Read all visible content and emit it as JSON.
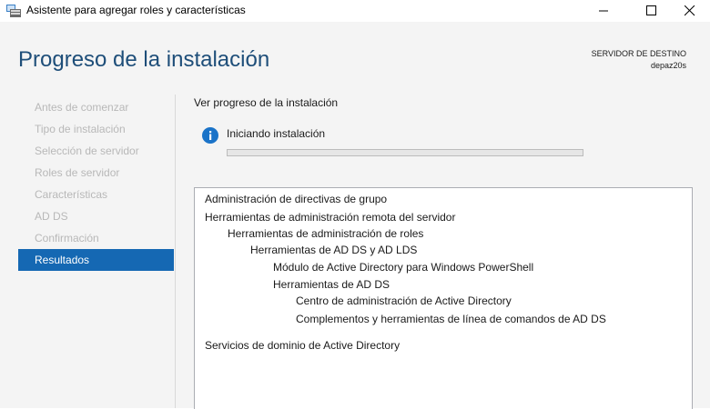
{
  "window": {
    "title": "Asistente para agregar roles y características",
    "icon": "server-manager-icon"
  },
  "header": {
    "page_title": "Progreso de la instalación",
    "server_label": "SERVIDOR DE DESTINO",
    "server_name": "depaz20s"
  },
  "sidebar": {
    "items": [
      {
        "label": "Antes de comenzar"
      },
      {
        "label": "Tipo de instalación"
      },
      {
        "label": "Selección de servidor"
      },
      {
        "label": "Roles de servidor"
      },
      {
        "label": "Características"
      },
      {
        "label": "AD DS"
      },
      {
        "label": "Confirmación"
      },
      {
        "label": "Resultados"
      }
    ],
    "active_index": 7
  },
  "main": {
    "section_label": "Ver progreso de la instalación",
    "status_icon": "info-icon",
    "status_text": "Iniciando instalación",
    "progress_fraction": 0,
    "results": [
      {
        "label": "Administración de directivas de grupo",
        "level": 0
      },
      {
        "label": "Herramientas de administración remota del servidor",
        "level": 0
      },
      {
        "label": "Herramientas de administración de roles",
        "level": 1
      },
      {
        "label": "Herramientas de AD DS y AD LDS",
        "level": 2
      },
      {
        "label": "Módulo de Active Directory para Windows PowerShell",
        "level": 3
      },
      {
        "label": "Herramientas de AD DS",
        "level": 3
      },
      {
        "label": "Centro de administración de Active Directory",
        "level": 4
      },
      {
        "label": "Complementos y herramientas de línea de comandos de AD DS",
        "level": 4
      },
      {
        "label": "Servicios de dominio de Active Directory",
        "level": 0
      }
    ]
  },
  "colors": {
    "accent": "#1568b3",
    "title": "#1e4e79",
    "info_icon": "#1a73c8"
  }
}
